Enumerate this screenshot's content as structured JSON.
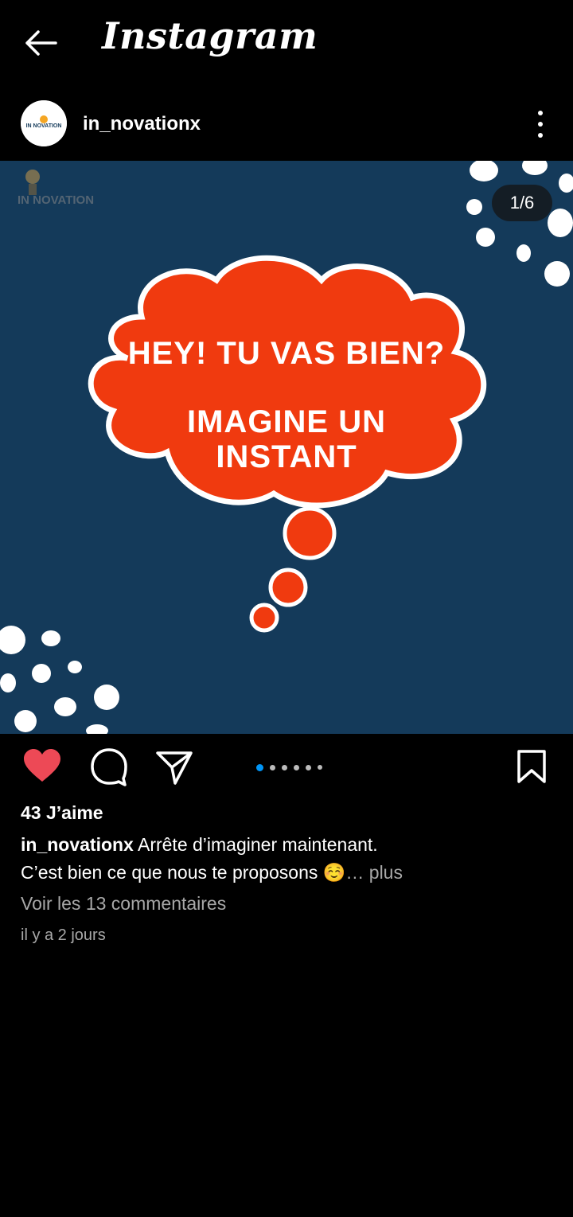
{
  "app": {
    "title": "Instagram"
  },
  "icons": {
    "back": "arrow-left-icon",
    "more": "vertical-dots-icon",
    "like": "heart-icon",
    "comment": "comment-bubble-icon",
    "share": "paper-plane-icon",
    "save": "bookmark-icon"
  },
  "post": {
    "username": "in_novationx",
    "avatar_text": "IN NOVATION",
    "watermark_text": "IN NOVATION",
    "media_counter": "1/6",
    "carousel": {
      "current": 1,
      "total": 6
    },
    "image_text": {
      "line1": "HEY! TU VAS BIEN?",
      "line2": "IMAGINE UN",
      "line3": "INSTANT"
    },
    "liked": true,
    "likes": "43 J’aime",
    "caption_username": "in_novationx",
    "caption_line1": " Arrête d’imaginer maintenant.",
    "caption_line2": "C’est bien ce que nous te proposons ☺️",
    "caption_more": "… plus",
    "view_comments": "Voir les 13 commentaires",
    "timestamp": "il y a 2 jours"
  },
  "colors": {
    "background": "#000000",
    "media_bg": "#143a5a",
    "bubble": "#f03a0f",
    "like_red": "#ed4956",
    "active_dot": "#0095f6"
  }
}
